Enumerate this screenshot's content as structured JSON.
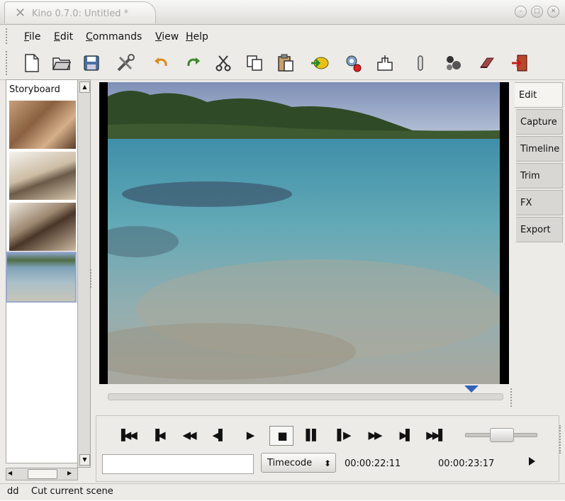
{
  "window": {
    "title": "Kino 0.7.0: Untitled *",
    "controls": [
      "minimize-icon",
      "maximize-icon",
      "close-icon"
    ]
  },
  "menu": {
    "items": [
      {
        "label": "File"
      },
      {
        "label": "Edit"
      },
      {
        "label": "Commands"
      },
      {
        "label": "View"
      },
      {
        "label": "Help"
      }
    ]
  },
  "toolbar": {
    "icons": [
      "new-file-icon",
      "open-folder-icon",
      "save-icon",
      "preferences-tools-icon",
      "undo-icon",
      "redo-icon",
      "cut-icon",
      "copy-icon",
      "paste-icon",
      "import-icon",
      "settings-gear-icon",
      "publish-icon",
      "split-icon",
      "join-icon",
      "undo-history-icon",
      "quit-icon"
    ]
  },
  "storyboard": {
    "label": "Storyboard"
  },
  "side_tabs": [
    {
      "label": "Edit",
      "active": true
    },
    {
      "label": "Capture"
    },
    {
      "label": "Timeline"
    },
    {
      "label": "Trim"
    },
    {
      "label": "FX"
    },
    {
      "label": "Export"
    }
  ],
  "scrubber": {
    "position_fraction": 0.92
  },
  "playback": {
    "buttons": [
      "start-icon",
      "prev-scene-icon",
      "rewind-icon",
      "step-back-icon",
      "play-icon",
      "stop-icon",
      "pause-icon",
      "step-forward-icon",
      "fast-forward-icon",
      "next-scene-icon",
      "end-icon"
    ],
    "shuttle_fraction": 0.5
  },
  "timecode": {
    "input_value": "",
    "format": "Timecode",
    "current": "00:00:22:11",
    "total": "00:00:23:17"
  },
  "status": {
    "key": "dd",
    "message": "Cut current scene"
  },
  "colors": {
    "accent": "#2f63b8",
    "window_bg": "#ecebe8"
  }
}
